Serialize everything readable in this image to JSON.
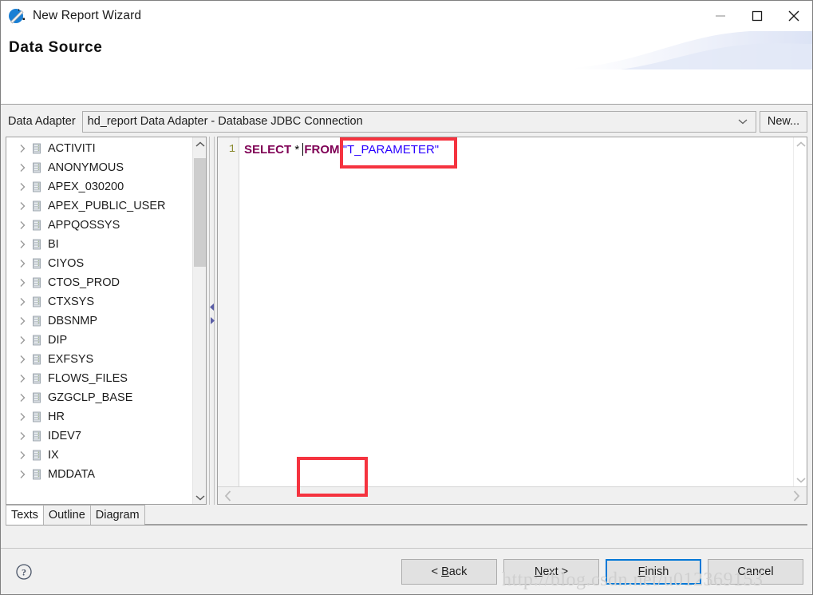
{
  "window": {
    "title": "New Report Wizard",
    "icon": "jaspersoft-app-icon",
    "controls": {
      "minimize": "minimize-icon",
      "maximize": "maximize-icon",
      "close": "close-icon"
    }
  },
  "header": {
    "title": "Data Source"
  },
  "adapter": {
    "label": "Data Adapter",
    "value": "hd_report Data Adapter  - Database JDBC Connection",
    "dropdown_icon": "chevron-down-icon",
    "new_button": "New..."
  },
  "tree": {
    "items": [
      {
        "label": "ACTIVITI"
      },
      {
        "label": "ANONYMOUS"
      },
      {
        "label": "APEX_030200"
      },
      {
        "label": "APEX_PUBLIC_USER"
      },
      {
        "label": "APPQOSSYS"
      },
      {
        "label": "BI"
      },
      {
        "label": "CIYOS"
      },
      {
        "label": "CTOS_PROD"
      },
      {
        "label": "CTXSYS"
      },
      {
        "label": "DBSNMP"
      },
      {
        "label": "DIP"
      },
      {
        "label": "EXFSYS"
      },
      {
        "label": "FLOWS_FILES"
      },
      {
        "label": "GZGCLP_BASE"
      },
      {
        "label": "HR"
      },
      {
        "label": "IDEV7"
      },
      {
        "label": "IX"
      },
      {
        "label": "MDDATA"
      }
    ],
    "expand_icon": "chevron-right-icon",
    "node_icon": "database-schema-icon",
    "scroll_up_icon": "scroll-up-icon",
    "scroll_down_icon": "scroll-down-icon"
  },
  "splitter": {
    "collapse_left_icon": "collapse-left-icon",
    "collapse_right_icon": "collapse-right-icon"
  },
  "editor": {
    "line_number": "1",
    "sql": {
      "keyword1": "SELECT",
      "star": " * ",
      "keyword2": "FROM",
      "space": " ",
      "table": "\"T_PARAMETER\""
    },
    "scroll_up_icon": "scroll-up-icon",
    "scroll_down_icon": "scroll-down-icon",
    "scroll_left_icon": "scroll-left-icon",
    "scroll_right_icon": "scroll-right-icon"
  },
  "tabs": [
    {
      "label": "Texts",
      "active": true
    },
    {
      "label": "Outline",
      "active": false
    },
    {
      "label": "Diagram",
      "active": false
    }
  ],
  "footer": {
    "help_icon": "help-icon",
    "buttons": [
      {
        "prefix": "< ",
        "mnemonic": "B",
        "suffix": "ack",
        "default": false
      },
      {
        "prefix": "",
        "mnemonic": "N",
        "suffix": "ext >",
        "default": false
      },
      {
        "prefix": "",
        "mnemonic": "F",
        "suffix": "inish",
        "default": true
      },
      {
        "prefix": "",
        "mnemonic": "",
        "suffix": "Cancel",
        "default": false
      }
    ]
  },
  "annotations": {
    "watermark": "http://blog.csdn.net/u012369153",
    "highlight_sql": "red-highlight-box-table-name",
    "highlight_diagram": "red-highlight-box-diagram-tab"
  },
  "colors": {
    "accent": "#0078d7",
    "annotation_red": "#f5333f",
    "sql_keyword": "#7f0055",
    "sql_string": "#2a00ff",
    "line_number": "#8a8a2f"
  }
}
